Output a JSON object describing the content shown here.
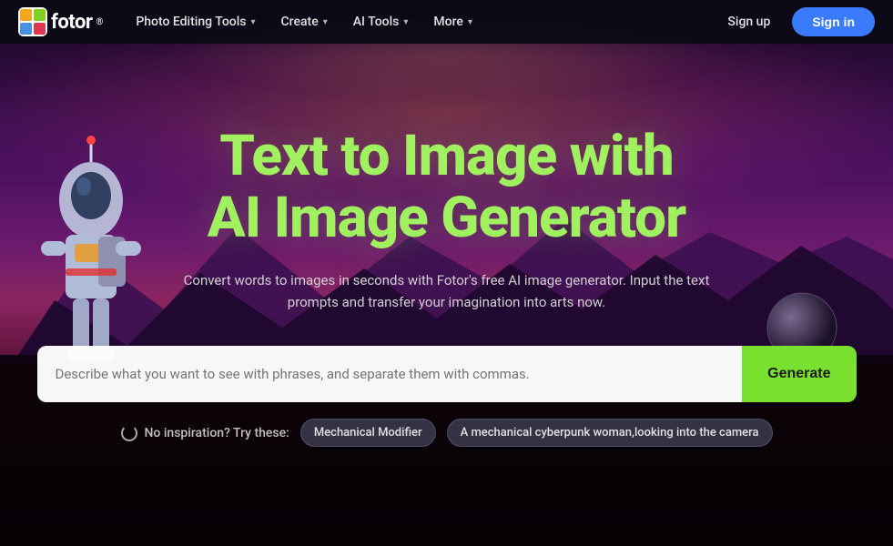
{
  "brand": {
    "logo_text": "fotor",
    "logo_sup": "®"
  },
  "navbar": {
    "items": [
      {
        "label": "Photo Editing Tools",
        "has_chevron": true
      },
      {
        "label": "Create",
        "has_chevron": true
      },
      {
        "label": "AI Tools",
        "has_chevron": true
      },
      {
        "label": "More",
        "has_chevron": true
      }
    ],
    "signup_label": "Sign up",
    "signin_label": "Sign in"
  },
  "hero": {
    "title_line1": "Text to Image with",
    "title_line2": "AI Image Generator",
    "subtitle": "Convert words to images in seconds with Fotor's free AI image generator. Input the text prompts and transfer your imagination into arts now.",
    "input_placeholder": "Describe what you want to see with phrases, and separate them with commas.",
    "generate_label": "Generate",
    "inspiration_label": "No inspiration? Try these:",
    "suggestions": [
      {
        "label": "Mechanical Modifier"
      },
      {
        "label": "A mechanical cyberpunk woman,looking into the camera"
      }
    ]
  },
  "colors": {
    "accent_green": "#7ae030",
    "title_green": "#a0f060",
    "nav_bg": "rgba(10,10,20,0.92)",
    "signin_blue": "#3a7bfd"
  }
}
